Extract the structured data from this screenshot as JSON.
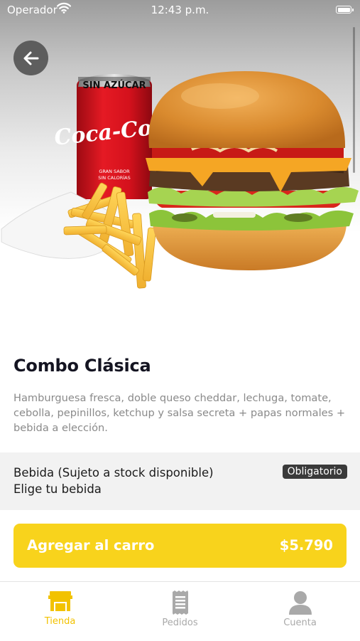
{
  "status_bar": {
    "carrier": "Operador",
    "time": "12:43 p.m."
  },
  "hero": {
    "can_label": "SIN AZÚCAR",
    "can_brand": "Coca-Cola",
    "can_small_1": "GRAN SABOR",
    "can_small_2": "SIN CALORÍAS"
  },
  "product": {
    "title": "Combo Clásica",
    "description": "Hamburguesa fresca, doble queso cheddar, lechuga, tomate, cebolla, pepinillos, ketchup y salsa secreta + papas normales + bebida a elección."
  },
  "option": {
    "title": "Bebida (Sujeto a stock disponible)",
    "subtitle": "Elige tu bebida",
    "badge": "Obligatorio"
  },
  "cart_button": {
    "label": "Agregar al carro",
    "price": "$5.790"
  },
  "tabs": [
    {
      "label": "Tienda",
      "icon": "store-icon",
      "active": true
    },
    {
      "label": "Pedidos",
      "icon": "receipt-icon",
      "active": false
    },
    {
      "label": "Cuenta",
      "icon": "user-icon",
      "active": false
    }
  ],
  "colors": {
    "accent": "#f8d31c",
    "active_tab": "#f2c200",
    "inactive_tab": "#a9a9a9",
    "badge_bg": "#3a3a3a"
  }
}
